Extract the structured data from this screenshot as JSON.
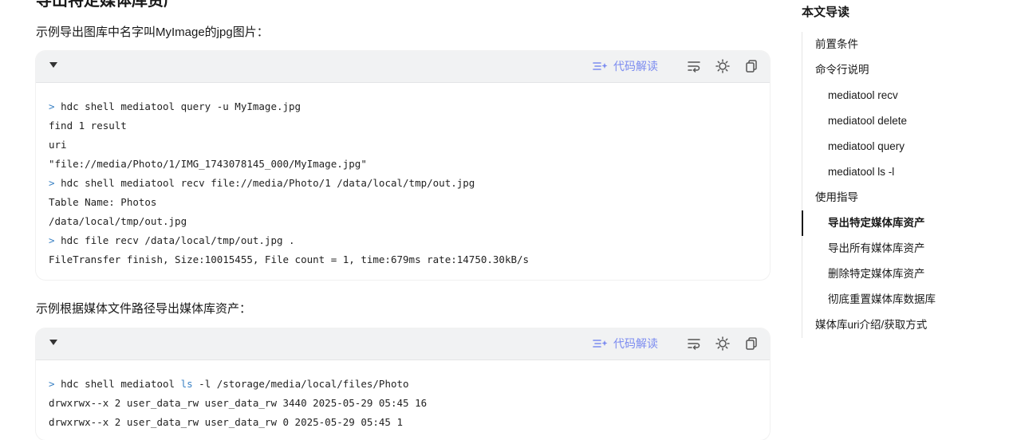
{
  "main": {
    "heading": "导出特定媒体库资产",
    "para1": "示例导出图库中名字叫MyImage的jpg图片：",
    "para2": "示例根据媒体文件路径导出媒体库资产：",
    "toolbar": {
      "explain_label": "代码解读"
    },
    "code1": {
      "lines": [
        "hdc shell mediatool query -u MyImage.jpg",
        "find 1 result",
        "uri",
        "\"file://media/Photo/1/IMG_1743078145_000/MyImage.jpg\"",
        "hdc shell mediatool recv file://media/Photo/1 /data/local/tmp/out.jpg",
        "Table Name: Photos",
        "/data/local/tmp/out.jpg",
        "hdc file recv /data/local/tmp/out.jpg .",
        "FileTransfer finish, Size:10015455, File count = 1, time:679ms rate:14750.30kB/s"
      ]
    },
    "code2": {
      "line1_pre": "hdc shell mediatool ",
      "line1_kw": "ls",
      "line1_post": " -l /storage/media/local/files/Photo",
      "line2": "drwxrwx--x 2 user_data_rw user_data_rw 3440 2025-05-29 05:45 16",
      "line3": "drwxrwx--x 2 user_data_rw user_data_rw 0 2025-05-29 05:45 1"
    },
    "prompt_symbol": ">"
  },
  "toc": {
    "title": "本文导读",
    "items": [
      "前置条件",
      "命令行说明",
      "mediatool recv",
      "mediatool delete",
      "mediatool query",
      "mediatool ls -l",
      "使用指导",
      "导出特定媒体库资产",
      "导出所有媒体库资产",
      "删除特定媒体库资产",
      "彻底重置媒体库数据库",
      "媒体库uri介绍/获取方式"
    ],
    "active_index": 7
  },
  "colors": {
    "accent": "#7c8cf0",
    "prompt": "#3b82c4",
    "code_header_bg": "#f1f2f3"
  },
  "icons": [
    "chevron-down-icon",
    "ai-explain-icon",
    "word-wrap-icon",
    "theme-sun-icon",
    "copy-icon"
  ]
}
